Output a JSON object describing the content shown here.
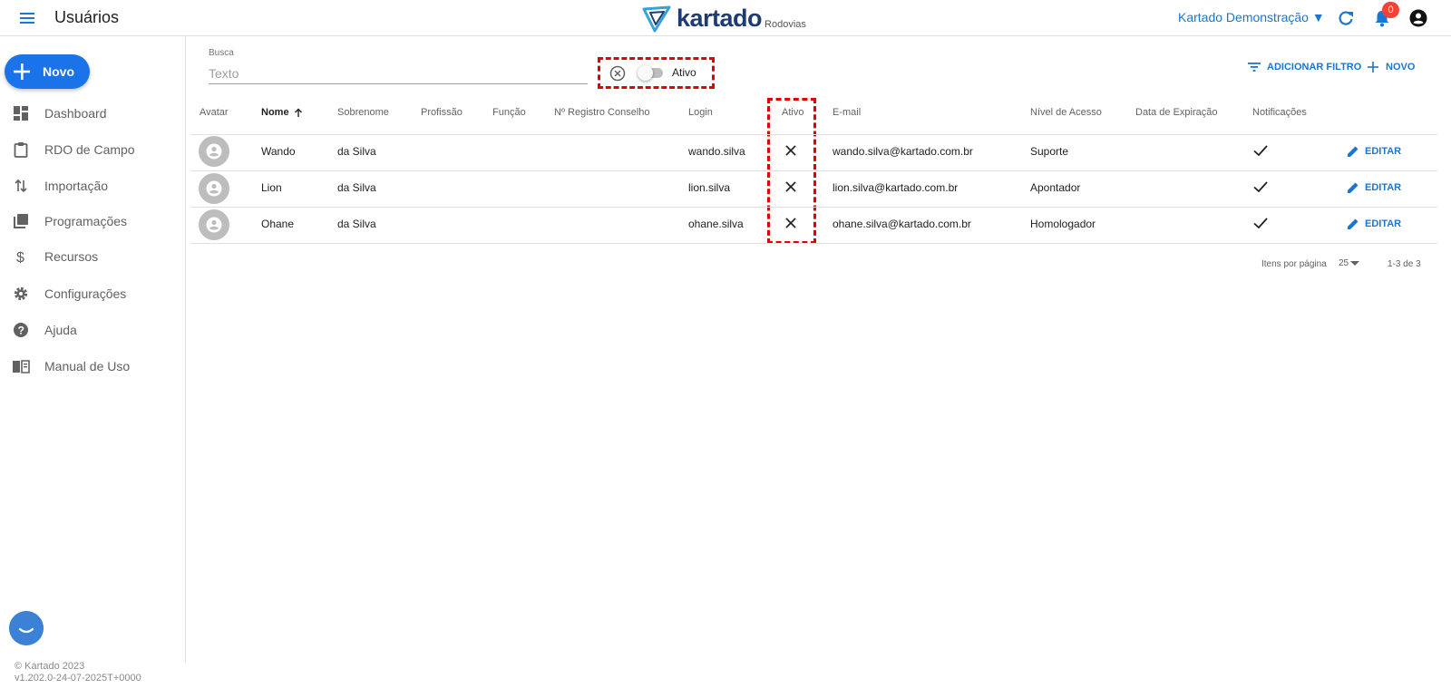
{
  "header": {
    "title": "Usuários",
    "logo_text": "kartado",
    "logo_subtext": "Rodovias",
    "company": "Kartado Demonstração ▼",
    "notification_count": "0"
  },
  "sidebar": {
    "new_button": "Novo",
    "items": [
      {
        "label": "Dashboard",
        "icon": "dashboard-icon"
      },
      {
        "label": "RDO de Campo",
        "icon": "clipboard-icon"
      },
      {
        "label": "Importação",
        "icon": "import-arrows-icon"
      },
      {
        "label": "Programações",
        "icon": "library-books-icon"
      },
      {
        "label": "Recursos",
        "icon": "dollar-icon"
      },
      {
        "label": "Configurações",
        "icon": "gear-icon"
      },
      {
        "label": "Ajuda",
        "icon": "help-icon"
      },
      {
        "label": "Manual de Uso",
        "icon": "book-icon"
      }
    ],
    "footer_copyright": "© Kartado 2023",
    "footer_version": "v1.202.0-24-07-2025T+0000"
  },
  "search": {
    "label": "Busca",
    "placeholder": "Texto",
    "value": "",
    "active_toggle_label": "Ativo",
    "active_toggle_on": false
  },
  "toolbar": {
    "add_filter": "ADICIONAR FILTRO",
    "new": "NOVO"
  },
  "table": {
    "columns": [
      "Avatar",
      "Nome",
      "Sobrenome",
      "Profissão",
      "Função",
      "Nº Registro Conselho",
      "Login",
      "Ativo",
      "E-mail",
      "Nível de Acesso",
      "Data de Expiração",
      "Notificações"
    ],
    "sorted_column": "Nome",
    "rows": [
      {
        "nome": "Wando",
        "sobrenome": "da Silva",
        "profissao": "",
        "funcao": "",
        "registro": "",
        "login": "wando.silva",
        "ativo": false,
        "email": "wando.silva@kartado.com.br",
        "nivel": "Suporte",
        "expiracao": "",
        "notificacoes": true,
        "edit": "EDITAR"
      },
      {
        "nome": "Lion",
        "sobrenome": "da Silva",
        "profissao": "",
        "funcao": "",
        "registro": "",
        "login": "lion.silva",
        "ativo": false,
        "email": "lion.silva@kartado.com.br",
        "nivel": "Apontador",
        "expiracao": "",
        "notificacoes": true,
        "edit": "EDITAR"
      },
      {
        "nome": "Ohane",
        "sobrenome": "da Silva",
        "profissao": "",
        "funcao": "",
        "registro": "",
        "login": "ohane.silva",
        "ativo": false,
        "email": "ohane.silva@kartado.com.br",
        "nivel": "Homologador",
        "expiracao": "",
        "notificacoes": true,
        "edit": "EDITAR"
      }
    ]
  },
  "pagination": {
    "items_per_page_label": "Itens por página",
    "items_per_page": "25",
    "range": "1-3 de 3"
  },
  "colors": {
    "accent": "#1976d2",
    "primary_button": "#1a73e8",
    "badge": "#f44336",
    "highlight_box": "#e00000"
  }
}
